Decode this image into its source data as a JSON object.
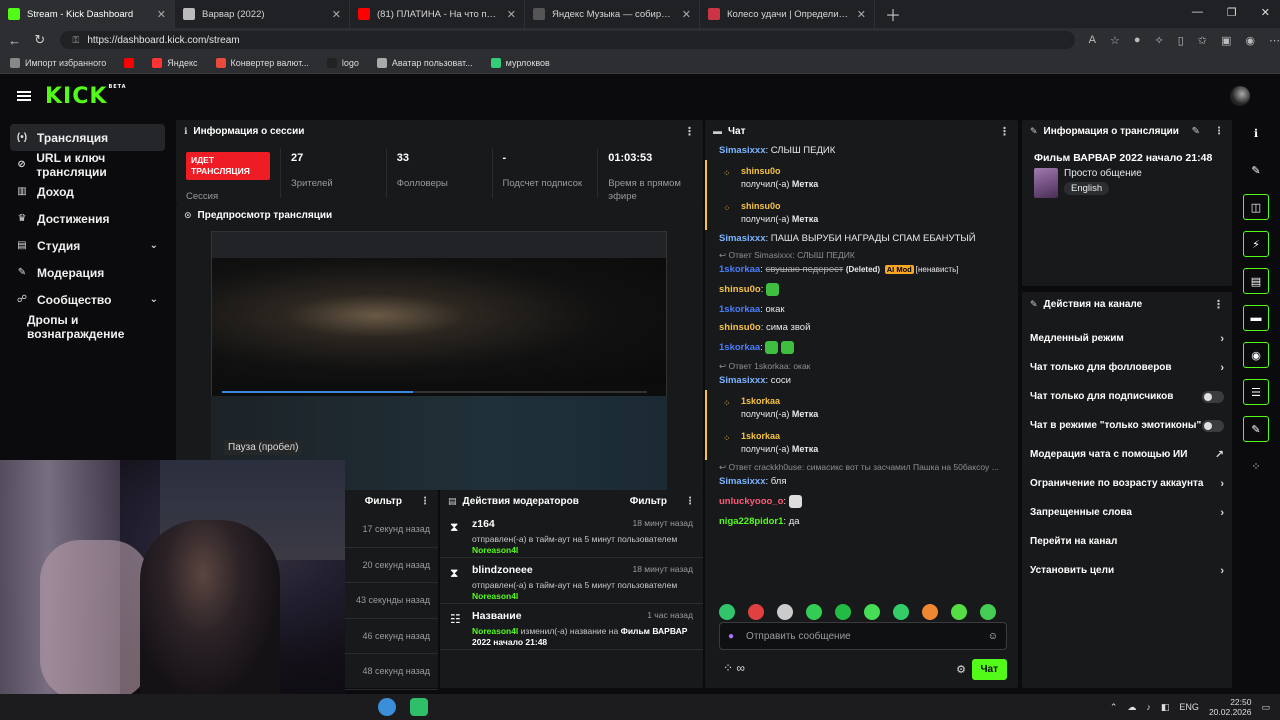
{
  "browser": {
    "tabs": [
      {
        "title": "Stream - Kick Dashboard",
        "color": "#53fc18",
        "active": true
      },
      {
        "title": "Варвар (2022)",
        "color": "#bbbbbb",
        "active": false
      },
      {
        "title": "(81) ПЛАТИНА - На что потратить...",
        "color": "#ff0000",
        "active": false
      },
      {
        "title": "Яндекс Музыка — собираем му...",
        "color": "#555555",
        "active": false
      },
      {
        "title": "Колесо удачи | Определите побе...",
        "color": "#cc3344",
        "active": false
      }
    ],
    "url": "https://dashboard.kick.com/stream",
    "bookmarks": [
      {
        "label": "Импорт избранного",
        "color": "#888"
      },
      {
        "label": "",
        "color": "#ff0000"
      },
      {
        "label": "Яндекс",
        "color": "#ff3333"
      },
      {
        "label": "Конвертер валют...",
        "color": "#e84b3c"
      },
      {
        "label": "logo",
        "color": "#222"
      },
      {
        "label": "Аватар пользоват...",
        "color": "#aaa"
      },
      {
        "label": "мурлоквов",
        "color": "#33cc77"
      }
    ]
  },
  "kick": {
    "logo": "KICK",
    "beta": "BETA",
    "nav": [
      {
        "label": "Трансляция",
        "icon": "(•)",
        "active": true,
        "chevron": false
      },
      {
        "label": "URL и ключ трансляции",
        "icon": "⊘",
        "active": false,
        "chevron": false
      },
      {
        "label": "Доход",
        "icon": "▥",
        "active": false,
        "chevron": false
      },
      {
        "label": "Достижения",
        "icon": "♛",
        "active": false,
        "chevron": false
      },
      {
        "label": "Студия",
        "icon": "▤",
        "active": false,
        "chevron": true
      },
      {
        "label": "Модерация",
        "icon": "✎",
        "active": false,
        "chevron": false
      },
      {
        "label": "Сообщество",
        "icon": "☍",
        "active": false,
        "chevron": true
      },
      {
        "label": "Дропы и вознаграждение",
        "icon": "",
        "active": false,
        "chevron": false,
        "sub": true
      }
    ]
  },
  "session": {
    "title": "Информация о сессии",
    "live_badge": "ИДЕТ ТРАНСЛЯЦИЯ",
    "live_label": "Сессия",
    "stats": [
      {
        "value": "27",
        "label": "Зрителей"
      },
      {
        "value": "33",
        "label": "Фолловеры"
      },
      {
        "value": "-",
        "label": "Подсчет подписок"
      },
      {
        "value": "01:03:53",
        "label": "Время в прямом эфире"
      }
    ]
  },
  "preview": {
    "title": "Предпросмотр трансляции",
    "pause_tip": "Пауза (пробел)"
  },
  "activity": {
    "filter": "Фильтр",
    "times": [
      "17 секунд назад",
      "20 секунд назад",
      "43 секунды назад",
      "46 секунд назад",
      "48 секунд назад"
    ]
  },
  "modactions": {
    "title": "Действия модераторов",
    "filter": "Фильтр",
    "items": [
      {
        "icon": "⧗",
        "name": "z164",
        "time": "18 минут назад",
        "desc": "отправлен(-а) в тайм-аут на 5 минут пользователем",
        "by": "Noreason4l",
        "extra": ""
      },
      {
        "icon": "⧗",
        "name": "blindzoneee",
        "time": "18 минут назад",
        "desc": "отправлен(-а) в тайм-аут на 5 минут пользователем",
        "by": "Noreason4l",
        "extra": ""
      },
      {
        "icon": "☷",
        "name": "Название",
        "time": "1 час назад",
        "desc": "изменил(-а) название на",
        "by": "Noreason4l",
        "extra": "Фильм ВАРВАР 2022 начало 21:48"
      }
    ]
  },
  "chat": {
    "title": "Чат",
    "messages": [
      {
        "kind": "msg",
        "user": "Simasixxx",
        "color": "#7ab4ff",
        "text": "СЛЫШ ПЕДИК"
      },
      {
        "kind": "sys",
        "user": "shinsu0o",
        "text": "получил(-а)",
        "item": "Метка"
      },
      {
        "kind": "sys",
        "user": "shinsu0o",
        "text": "получил(-а)",
        "item": "Метка"
      },
      {
        "kind": "msg",
        "user": "Simasixxx",
        "color": "#7ab4ff",
        "text": "ПАША ВЫРУБИ НАГРАДЫ СПАМ ЕБАНУТЫЙ"
      },
      {
        "kind": "reply",
        "text": "↩ Ответ Simasixxx: СЛЫШ ПЕДИК"
      },
      {
        "kind": "deleted",
        "user": "1skorkaa",
        "color": "#4a7dff",
        "text": "свушаю педерест",
        "deleted": "(Deleted)",
        "mod": "AI Mod",
        "reason": "[ненависть]"
      },
      {
        "kind": "emote",
        "user": "shinsu0o",
        "color": "#f6c344",
        "text": ""
      },
      {
        "kind": "msg",
        "user": "1skorkaa",
        "color": "#4a7dff",
        "text": "окак"
      },
      {
        "kind": "msg",
        "user": "shinsu0o",
        "color": "#f6c344",
        "text": "сима звой"
      },
      {
        "kind": "emote2",
        "user": "1skorkaa",
        "color": "#4a7dff",
        "text": ""
      },
      {
        "kind": "reply",
        "text": "↩ Ответ 1skorkaa: окак"
      },
      {
        "kind": "msg",
        "user": "Simasixxx",
        "color": "#7ab4ff",
        "text": "соси"
      },
      {
        "kind": "sys",
        "user": "1skorkaa",
        "text": "получил(-а)",
        "item": "Метка"
      },
      {
        "kind": "sys",
        "user": "1skorkaa",
        "text": "получил(-а)",
        "item": "Метка"
      },
      {
        "kind": "reply",
        "text": "↩ Ответ crackkh0use: симасикс вот ты засчамил Пашка на 50баксоу ..."
      },
      {
        "kind": "msg",
        "user": "Simasixxx",
        "color": "#7ab4ff",
        "text": "бля"
      },
      {
        "kind": "emote3",
        "user": "unluckyooo_o",
        "color": "#ff5a7a",
        "text": ""
      },
      {
        "kind": "msg",
        "user": "niga228pidor1",
        "color": "#53fc18",
        "text": "да"
      }
    ],
    "emote_colors": [
      "#31c46a",
      "#e04040",
      "#cccccc",
      "#33cc55",
      "#22bb44",
      "#44dd55",
      "#33cc66",
      "#ee8833",
      "#55dd44",
      "#44cc55"
    ],
    "input_placeholder": "Отправить сообщение",
    "send_label": "Чат"
  },
  "streaminfo": {
    "title": "Информация о трансляции",
    "stream_title": "Фильм ВАРВАР 2022 начало 21:48",
    "category": "Просто общение",
    "language": "English"
  },
  "channelactions": {
    "title": "Действия на канале",
    "items": [
      {
        "label": "Медленный режим",
        "control": "chevron"
      },
      {
        "label": "Чат только для фолловеров",
        "control": "chevron"
      },
      {
        "label": "Чат только для подписчиков",
        "control": "toggle"
      },
      {
        "label": "Чат в режиме \"только эмотиконы\"",
        "control": "toggle"
      },
      {
        "label": "Модерация чата с помощью ИИ",
        "control": "external"
      },
      {
        "label": "Ограничение по возрасту аккаунта",
        "control": "chevron"
      },
      {
        "label": "Запрещенные слова",
        "control": "chevron"
      },
      {
        "label": "Перейти на канал",
        "control": "none"
      },
      {
        "label": "Установить цели",
        "control": "chevron"
      }
    ]
  },
  "taskbar": {
    "lang": "ENG",
    "time": "22:50",
    "date": "20.02.2026"
  }
}
